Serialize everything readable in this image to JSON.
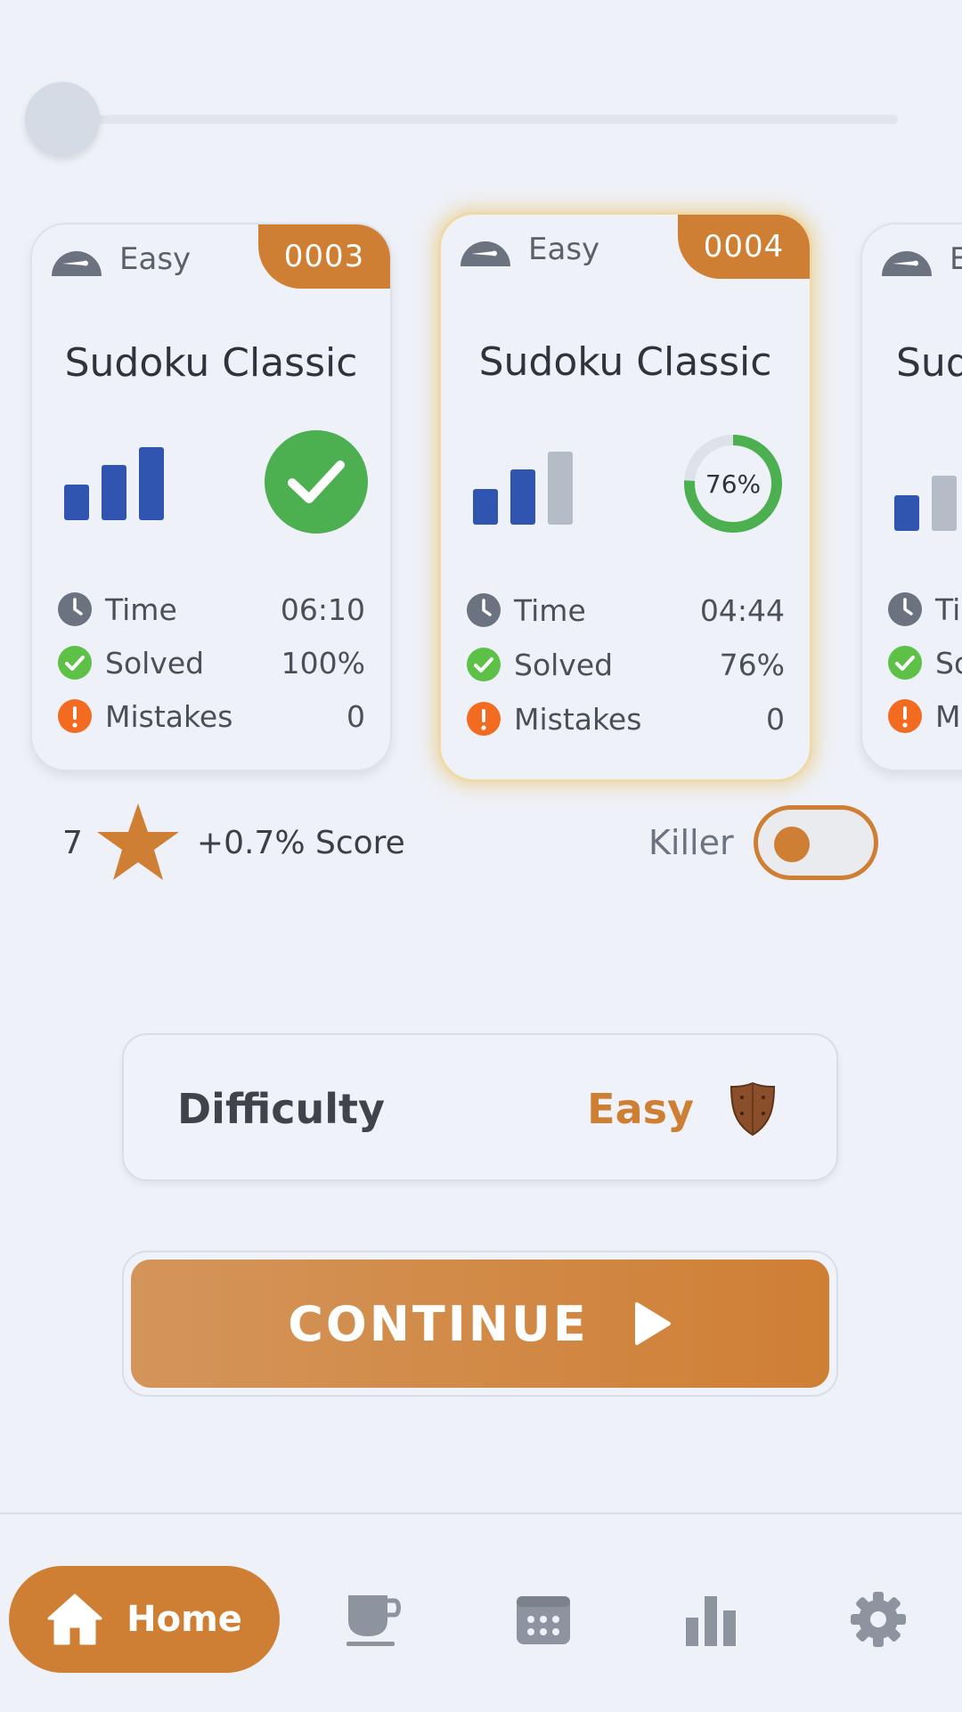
{
  "slider": {
    "value": 0
  },
  "cards": [
    {
      "level": "Easy",
      "badge": "0003",
      "title": "Sudoku Classic",
      "bars_filled": 3,
      "completed": true,
      "time_label": "Time",
      "time": "06:10",
      "solved_label": "Solved",
      "solved": "100%",
      "mistakes_label": "Mistakes",
      "mistakes": "0"
    },
    {
      "level": "Easy",
      "badge": "0004",
      "title": "Sudoku Classic",
      "bars_filled": 2,
      "progress": 76,
      "progress_label": "76%",
      "time_label": "Time",
      "time": "04:44",
      "solved_label": "Solved",
      "solved": "76%",
      "mistakes_label": "Mistakes",
      "mistakes": "0"
    },
    {
      "level": "Easy",
      "title": "Sudoku Classic",
      "time_label": "Time",
      "solved_label": "Solved",
      "mistakes_label": "Mistakes"
    }
  ],
  "score": {
    "stars": "7",
    "text": "+0.7% Score"
  },
  "killer": {
    "label": "Killer",
    "enabled": false
  },
  "difficulty": {
    "label": "Difficulty",
    "value": "Easy"
  },
  "continue": {
    "label": "CONTINUE"
  },
  "nav": {
    "home_label": "Home"
  },
  "colors": {
    "accent": "#cf7f34",
    "bar_blue": "#2f55b0",
    "bar_gray": "#b4bcc8",
    "green": "#4caf50",
    "orange_alert": "#f26b21"
  },
  "icons": [
    "speedometer-icon",
    "clock-icon",
    "check-circle-icon",
    "alert-icon",
    "star-icon",
    "shield-icon",
    "play-icon",
    "home-icon",
    "coffee-icon",
    "calendar-icon",
    "stats-icon",
    "gear-icon"
  ]
}
